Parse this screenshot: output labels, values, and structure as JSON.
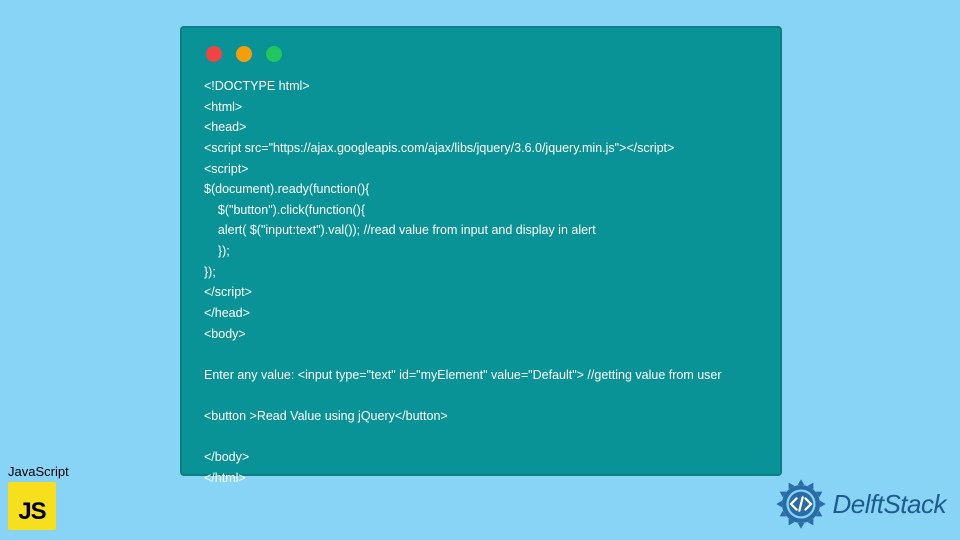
{
  "code": {
    "lines": [
      "<!DOCTYPE html>",
      "<html>",
      "<head>",
      "<script src=\"https://ajax.googleapis.com/ajax/libs/jquery/3.6.0/jquery.min.js\"></script>",
      "<script>",
      "$(document).ready(function(){",
      "    $(\"button\").click(function(){",
      "    alert( $(\"input:text\").val()); //read value from input and display in alert",
      "    });",
      "});",
      "</script>",
      "</head>",
      "<body>",
      "",
      "Enter any value: <input type=\"text\" id=\"myElement\" value=\"Default\"> //getting value from user",
      "",
      "<button >Read Value using jQuery</button>",
      "",
      "</body>",
      "</html>"
    ]
  },
  "js_badge": {
    "label": "JavaScript",
    "icon_text": "JS"
  },
  "delft": {
    "brand": "DelftStack"
  },
  "colors": {
    "window_bg": "#0a9396",
    "page_bg": "#87d4f7",
    "dot_red": "#ef4444",
    "dot_yellow": "#f59e0b",
    "dot_green": "#22c55e",
    "delft_blue": "#1e5b8f"
  }
}
